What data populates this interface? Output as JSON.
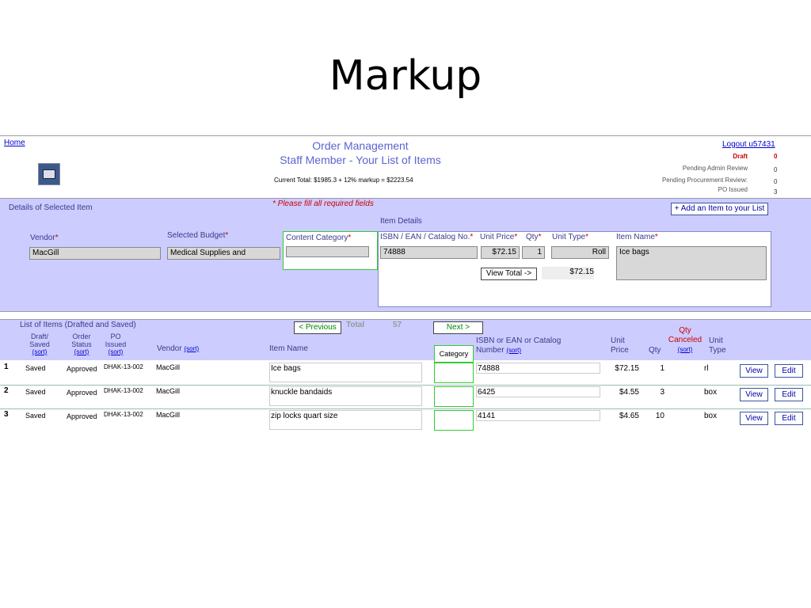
{
  "slide": {
    "title": "Markup"
  },
  "header": {
    "home": "Home",
    "title": "Order Management",
    "subtitle": "Staff Member - Your List of Items",
    "current_total": "Current Total:  $1985.3 + 12% markup = $2223.54",
    "logout": "Logout  u57431",
    "stats": [
      {
        "label": "Draft",
        "value": "0"
      },
      {
        "label": "Pending Admin Review",
        "value": "0"
      },
      {
        "label": "Pending Procurement Review:",
        "value": "0"
      },
      {
        "label": "PO Issued",
        "value": "3"
      }
    ]
  },
  "details": {
    "section_label": "Details of Selected Item",
    "required_note": "* Please fill all required fields",
    "add_button": "+ Add an Item to your List",
    "item_details_label": "Item Details",
    "vendor_label": "Vendor",
    "vendor_value": "MacGill",
    "budget_label": "Selected Budget",
    "budget_value": "Medical Supplies and",
    "content_category_label": "Content Category",
    "content_category_value": "",
    "isbn_label": "ISBN / EAN / Catalog No.",
    "isbn_value": "74888",
    "unit_price_label": "Unit Price",
    "unit_price_value": "$72.15",
    "qty_label": "Qty",
    "qty_value": "1",
    "unit_type_label": "Unit Type",
    "unit_type_value": "Roll",
    "item_name_label": "Item Name",
    "item_name_value": "Ice bags",
    "view_total_button": "View Total ->",
    "view_total_value": "$72.15",
    "asterisk": "*"
  },
  "list": {
    "title": "List of Items (Drafted and Saved)",
    "prev": "< Previous",
    "total_label": "Total",
    "total_value": "57",
    "next": "Next >",
    "sort": "(sort)",
    "columns": {
      "draft": "Draft/ Saved",
      "order_status": "Order Status",
      "po": "PO Issued",
      "vendor": "Vendor",
      "item_name": "Item Name",
      "category": "Category",
      "isbn": "ISBN or EAN or Catalog Number",
      "unit_price": "Unit Price",
      "qty": "Qty",
      "qty_canceled": "Qty Canceled",
      "unit_type": "Unit Type"
    },
    "view_label": "View",
    "edit_label": "Edit",
    "rows": [
      {
        "n": "1",
        "saved": "Saved",
        "status": "Approved",
        "po": "DHAK-13-002",
        "vendor": "MacGill",
        "item": "Ice bags",
        "isbn": "74888",
        "price": "$72.15",
        "qty": "1",
        "unit": "rl"
      },
      {
        "n": "2",
        "saved": "Saved",
        "status": "Approved",
        "po": "DHAK-13-002",
        "vendor": "MacGill",
        "item": "knuckle bandaids",
        "isbn": "6425",
        "price": "$4.55",
        "qty": "3",
        "unit": "box"
      },
      {
        "n": "3",
        "saved": "Saved",
        "status": "Approved",
        "po": "DHAK-13-002",
        "vendor": "MacGill",
        "item": "zip locks quart size",
        "isbn": "4141",
        "price": "$4.65",
        "qty": "10",
        "unit": "box"
      }
    ]
  }
}
